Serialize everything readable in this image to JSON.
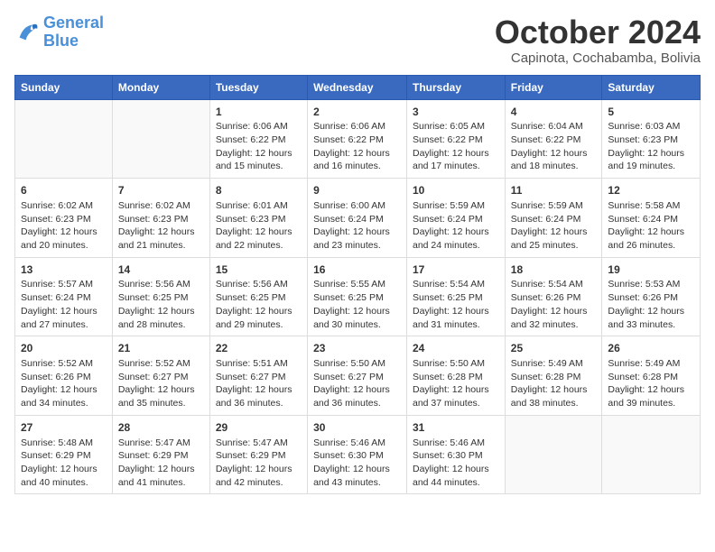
{
  "header": {
    "logo_line1": "General",
    "logo_line2": "Blue",
    "month": "October 2024",
    "location": "Capinota, Cochabamba, Bolivia"
  },
  "weekdays": [
    "Sunday",
    "Monday",
    "Tuesday",
    "Wednesday",
    "Thursday",
    "Friday",
    "Saturday"
  ],
  "weeks": [
    [
      {
        "day": "",
        "info": ""
      },
      {
        "day": "",
        "info": ""
      },
      {
        "day": "1",
        "info": "Sunrise: 6:06 AM\nSunset: 6:22 PM\nDaylight: 12 hours and 15 minutes."
      },
      {
        "day": "2",
        "info": "Sunrise: 6:06 AM\nSunset: 6:22 PM\nDaylight: 12 hours and 16 minutes."
      },
      {
        "day": "3",
        "info": "Sunrise: 6:05 AM\nSunset: 6:22 PM\nDaylight: 12 hours and 17 minutes."
      },
      {
        "day": "4",
        "info": "Sunrise: 6:04 AM\nSunset: 6:22 PM\nDaylight: 12 hours and 18 minutes."
      },
      {
        "day": "5",
        "info": "Sunrise: 6:03 AM\nSunset: 6:23 PM\nDaylight: 12 hours and 19 minutes."
      }
    ],
    [
      {
        "day": "6",
        "info": "Sunrise: 6:02 AM\nSunset: 6:23 PM\nDaylight: 12 hours and 20 minutes."
      },
      {
        "day": "7",
        "info": "Sunrise: 6:02 AM\nSunset: 6:23 PM\nDaylight: 12 hours and 21 minutes."
      },
      {
        "day": "8",
        "info": "Sunrise: 6:01 AM\nSunset: 6:23 PM\nDaylight: 12 hours and 22 minutes."
      },
      {
        "day": "9",
        "info": "Sunrise: 6:00 AM\nSunset: 6:24 PM\nDaylight: 12 hours and 23 minutes."
      },
      {
        "day": "10",
        "info": "Sunrise: 5:59 AM\nSunset: 6:24 PM\nDaylight: 12 hours and 24 minutes."
      },
      {
        "day": "11",
        "info": "Sunrise: 5:59 AM\nSunset: 6:24 PM\nDaylight: 12 hours and 25 minutes."
      },
      {
        "day": "12",
        "info": "Sunrise: 5:58 AM\nSunset: 6:24 PM\nDaylight: 12 hours and 26 minutes."
      }
    ],
    [
      {
        "day": "13",
        "info": "Sunrise: 5:57 AM\nSunset: 6:24 PM\nDaylight: 12 hours and 27 minutes."
      },
      {
        "day": "14",
        "info": "Sunrise: 5:56 AM\nSunset: 6:25 PM\nDaylight: 12 hours and 28 minutes."
      },
      {
        "day": "15",
        "info": "Sunrise: 5:56 AM\nSunset: 6:25 PM\nDaylight: 12 hours and 29 minutes."
      },
      {
        "day": "16",
        "info": "Sunrise: 5:55 AM\nSunset: 6:25 PM\nDaylight: 12 hours and 30 minutes."
      },
      {
        "day": "17",
        "info": "Sunrise: 5:54 AM\nSunset: 6:25 PM\nDaylight: 12 hours and 31 minutes."
      },
      {
        "day": "18",
        "info": "Sunrise: 5:54 AM\nSunset: 6:26 PM\nDaylight: 12 hours and 32 minutes."
      },
      {
        "day": "19",
        "info": "Sunrise: 5:53 AM\nSunset: 6:26 PM\nDaylight: 12 hours and 33 minutes."
      }
    ],
    [
      {
        "day": "20",
        "info": "Sunrise: 5:52 AM\nSunset: 6:26 PM\nDaylight: 12 hours and 34 minutes."
      },
      {
        "day": "21",
        "info": "Sunrise: 5:52 AM\nSunset: 6:27 PM\nDaylight: 12 hours and 35 minutes."
      },
      {
        "day": "22",
        "info": "Sunrise: 5:51 AM\nSunset: 6:27 PM\nDaylight: 12 hours and 36 minutes."
      },
      {
        "day": "23",
        "info": "Sunrise: 5:50 AM\nSunset: 6:27 PM\nDaylight: 12 hours and 36 minutes."
      },
      {
        "day": "24",
        "info": "Sunrise: 5:50 AM\nSunset: 6:28 PM\nDaylight: 12 hours and 37 minutes."
      },
      {
        "day": "25",
        "info": "Sunrise: 5:49 AM\nSunset: 6:28 PM\nDaylight: 12 hours and 38 minutes."
      },
      {
        "day": "26",
        "info": "Sunrise: 5:49 AM\nSunset: 6:28 PM\nDaylight: 12 hours and 39 minutes."
      }
    ],
    [
      {
        "day": "27",
        "info": "Sunrise: 5:48 AM\nSunset: 6:29 PM\nDaylight: 12 hours and 40 minutes."
      },
      {
        "day": "28",
        "info": "Sunrise: 5:47 AM\nSunset: 6:29 PM\nDaylight: 12 hours and 41 minutes."
      },
      {
        "day": "29",
        "info": "Sunrise: 5:47 AM\nSunset: 6:29 PM\nDaylight: 12 hours and 42 minutes."
      },
      {
        "day": "30",
        "info": "Sunrise: 5:46 AM\nSunset: 6:30 PM\nDaylight: 12 hours and 43 minutes."
      },
      {
        "day": "31",
        "info": "Sunrise: 5:46 AM\nSunset: 6:30 PM\nDaylight: 12 hours and 44 minutes."
      },
      {
        "day": "",
        "info": ""
      },
      {
        "day": "",
        "info": ""
      }
    ]
  ]
}
